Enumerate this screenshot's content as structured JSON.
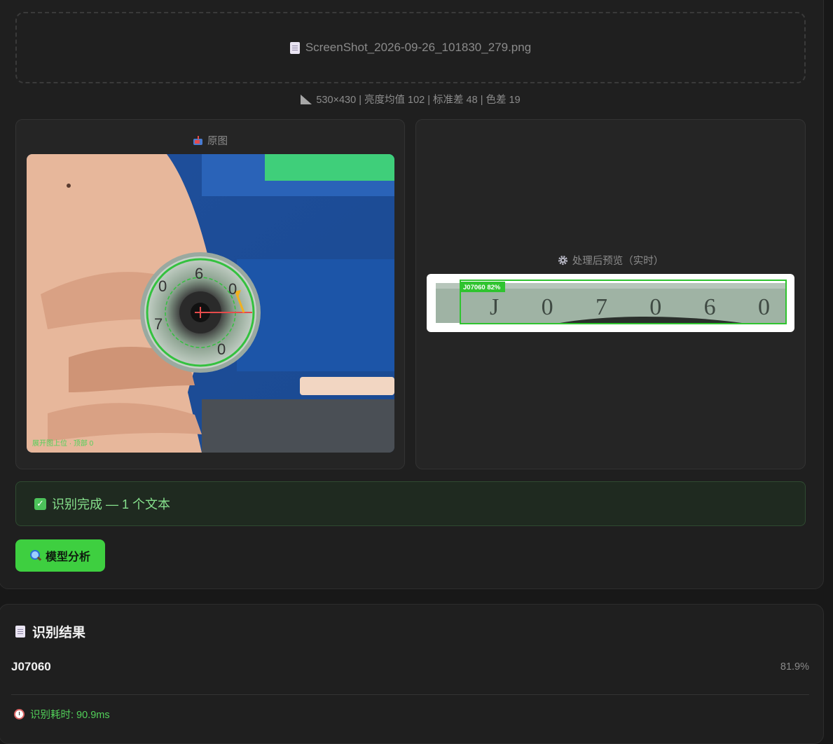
{
  "upload": {
    "filename": "ScreenShot_2026-09-26_101830_279.png",
    "icon": "file-icon"
  },
  "stats": {
    "text": "530×430 | 亮度均值 102 | 标准差 48 | 色差 19",
    "icon": "ruler-icon"
  },
  "panels": {
    "original": {
      "title": "原图",
      "icon": "mailbox-icon",
      "overlay_text": "展开图上位 · 顶部 0"
    },
    "processed": {
      "title": "处理后预览（实时）",
      "icon": "gear-icon",
      "detection_label": "J07060 82%",
      "strip_text": "J 0 7 0 6 0"
    }
  },
  "status": {
    "message": "识别完成 — 1 个文本",
    "icon": "check-icon"
  },
  "actions": {
    "analyze_label": "模型分析",
    "icon": "magnifier-icon"
  },
  "results": {
    "title": "识别结果",
    "icon": "document-icon",
    "items": [
      {
        "text": "J07060",
        "confidence": "81.9%"
      }
    ],
    "timing": "识别耗时: 90.9ms",
    "timing_icon": "clock-icon"
  },
  "colors": {
    "accent": "#3ecf40",
    "status_text": "#86e08c",
    "background": "#1f1f1f",
    "detection_box": "#2fc42f"
  }
}
